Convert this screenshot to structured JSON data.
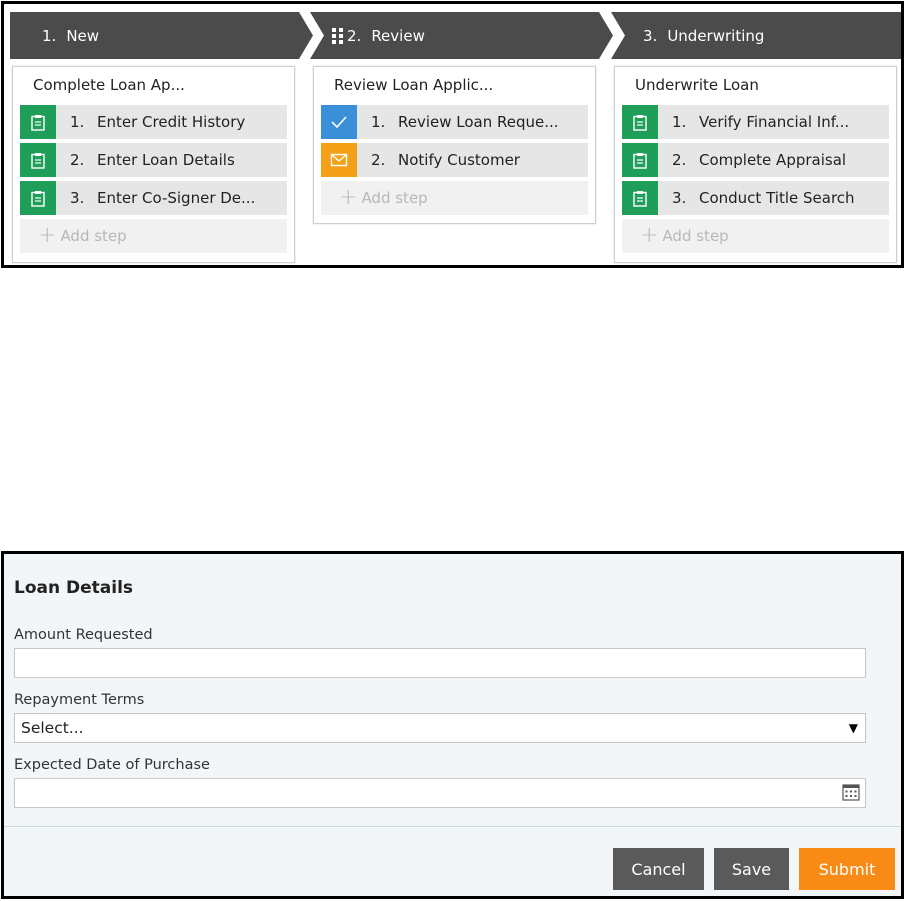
{
  "stages": [
    {
      "number": "1.",
      "name": "New",
      "process": "Complete Loan Ap...",
      "steps": [
        {
          "number": "1.",
          "label": "Enter Credit History",
          "icon": "clipboard-icon"
        },
        {
          "number": "2.",
          "label": "Enter Loan Details",
          "icon": "clipboard-icon"
        },
        {
          "number": "3.",
          "label": "Enter Co-Signer De...",
          "icon": "clipboard-icon"
        }
      ],
      "add_step": "Add step"
    },
    {
      "number": "2.",
      "name": "Review",
      "process": "Review Loan Applic...",
      "steps": [
        {
          "number": "1.",
          "label": "Review Loan Reque...",
          "icon": "checkmark-icon"
        },
        {
          "number": "2.",
          "label": "Notify Customer",
          "icon": "envelope-icon"
        }
      ],
      "add_step": "Add step"
    },
    {
      "number": "3.",
      "name": "Underwriting",
      "process": "Underwrite Loan",
      "steps": [
        {
          "number": "1.",
          "label": "Verify Financial Inf...",
          "icon": "clipboard-icon"
        },
        {
          "number": "2.",
          "label": "Complete Appraisal",
          "icon": "clipboard-icon"
        },
        {
          "number": "3.",
          "label": "Conduct Title Search",
          "icon": "clipboard-icon"
        }
      ],
      "add_step": "Add step"
    }
  ],
  "form": {
    "heading": "Loan Details",
    "amount_label": "Amount Requested",
    "amount_value": "",
    "terms_label": "Repayment Terms",
    "terms_selected": "Select...",
    "date_label": "Expected Date of Purchase",
    "date_value": ""
  },
  "buttons": {
    "cancel": "Cancel",
    "save": "Save",
    "submit": "Submit"
  },
  "colors": {
    "stage_header": "#4b4b4b",
    "assignment_green": "#1f9e5a",
    "approval_blue": "#3a8fd8",
    "email_orange": "#f5a117",
    "submit_orange": "#f88b16",
    "neutral_button": "#5a5a5a"
  }
}
